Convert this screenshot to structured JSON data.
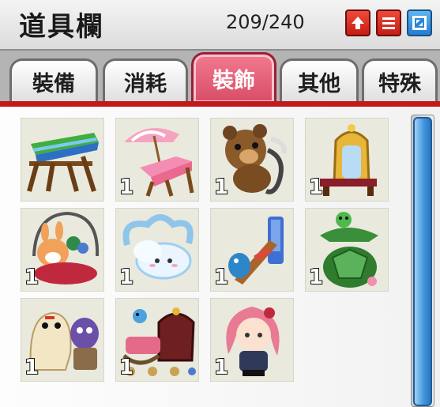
{
  "window": {
    "title": "道具欄",
    "count": "209/240"
  },
  "title_buttons": [
    {
      "icon": "pin-icon"
    },
    {
      "icon": "list-icon"
    },
    {
      "icon": "expand-icon"
    }
  ],
  "tabs": [
    {
      "label": "裝備",
      "active": false
    },
    {
      "label": "消耗",
      "active": false
    },
    {
      "label": "裝飾",
      "active": true
    },
    {
      "label": "其他",
      "active": false
    },
    {
      "label": "特殊",
      "active": false
    }
  ],
  "items": [
    {
      "name": "striped-beach-chair-icon",
      "qty": ""
    },
    {
      "name": "pink-parasol-deck-chair-icon",
      "qty": "1"
    },
    {
      "name": "teddy-bear-chair-icon",
      "qty": "1"
    },
    {
      "name": "golden-throne-chair-icon",
      "qty": "1"
    },
    {
      "name": "bunny-basket-chair-icon",
      "qty": "1"
    },
    {
      "name": "cloud-chair-icon",
      "qty": "1"
    },
    {
      "name": "dolphin-slide-chair-icon",
      "qty": "1"
    },
    {
      "name": "turtle-chair-icon",
      "qty": "1"
    },
    {
      "name": "ghost-friends-chair-icon",
      "qty": "1"
    },
    {
      "name": "royal-sofa-chair-icon",
      "qty": "1"
    },
    {
      "name": "pink-hair-girl-chair-icon",
      "qty": "1"
    }
  ],
  "colors": {
    "active_tab": "#e05a72",
    "accent_line": "#c21a1a",
    "scroll_thumb": "#3f93db"
  }
}
